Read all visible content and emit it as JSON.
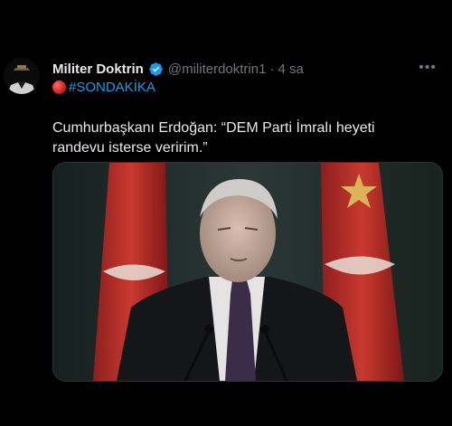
{
  "tweet": {
    "author_name": "Militer Doktrin",
    "handle": "@militerdoktrin1",
    "separator": "·",
    "time": "4 sa",
    "more_label": "•••",
    "hashtag": "#SONDAKİKA",
    "text": "Cumhurbaşkanı Erdoğan: “DEM Parti İmralı heyeti randevu isterse veririm.”"
  },
  "colors": {
    "background": "#000000",
    "text": "#e7e9ea",
    "muted": "#71767b",
    "link": "#1d9bf0",
    "verified": "#1d9bf0"
  },
  "icons": {
    "avatar": "avatar",
    "verified": "verified-badge-icon",
    "more": "more-options-icon",
    "red_circle": "red-circle-emoji"
  }
}
